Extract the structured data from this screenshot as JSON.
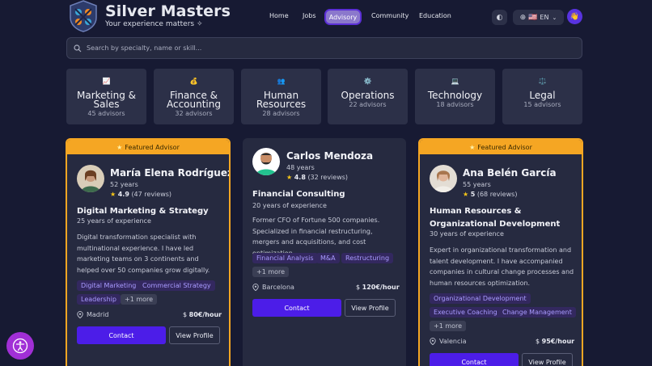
{
  "brand": {
    "title": "Silver Masters",
    "subtitle": "Your experience matters"
  },
  "nav": {
    "items": [
      "Home",
      "Jobs",
      "Advisory",
      "Community",
      "Education"
    ],
    "active": "Advisory"
  },
  "language": {
    "label": "EN",
    "flag": "🇺🇸"
  },
  "search": {
    "placeholder": "Search by specialty, name or skill..."
  },
  "categories": [
    {
      "icon": "📈",
      "icon_name": "chart-up-icon",
      "name_lines": [
        "Marketing &",
        "Sales"
      ],
      "count": "45 advisors"
    },
    {
      "icon": "💰",
      "icon_name": "money-bag-icon",
      "name_lines": [
        "Finance &",
        "Accounting"
      ],
      "count": "32 advisors"
    },
    {
      "icon": "👥",
      "icon_name": "people-icon",
      "name_lines": [
        "Human",
        "Resources"
      ],
      "count": "28 advisors"
    },
    {
      "icon": "⚙️",
      "icon_name": "gear-icon",
      "name_lines": [
        "Operations"
      ],
      "count": "22 advisors"
    },
    {
      "icon": "💻",
      "icon_name": "laptop-icon",
      "name_lines": [
        "Technology"
      ],
      "count": "18 advisors"
    },
    {
      "icon": "⚖️",
      "icon_name": "scales-icon",
      "name_lines": [
        "Legal"
      ],
      "count": "15 advisors"
    }
  ],
  "featured_label": "Featured Advisor",
  "advisors": [
    {
      "name": "María Elena Rodríguez",
      "age": "52 years",
      "rating": "4.9",
      "reviews": "(47 reviews)",
      "specialty": "Digital Marketing & Strategy",
      "experience": "25 years of experience",
      "bio": "Digital transformation specialist with multinational experience. I have led marketing teams on 3 continents and helped over 50 companies grow digitally.",
      "tags": [
        "Digital Marketing",
        "Commercial Strategy",
        "Leadership"
      ],
      "more": "+1 more",
      "location": "Madrid",
      "price": "80€/hour"
    },
    {
      "name": "Carlos Mendoza",
      "age": "48 years",
      "rating": "4.8",
      "reviews": "(32 reviews)",
      "specialty": "Financial Consulting",
      "experience": "20 years of experience",
      "bio": "Former CFO of Fortune 500 companies. Specialized in financial restructuring, mergers and acquisitions, and cost optimization.",
      "tags": [
        "Financial Analysis",
        "M&A",
        "Restructuring"
      ],
      "more": "+1 more",
      "location": "Barcelona",
      "price": "120€/hour"
    },
    {
      "name": "Ana Belén García",
      "age": "55 years",
      "rating": "5",
      "reviews": "(68 reviews)",
      "specialty": "Human Resources & Organizational Development",
      "experience": "30 years of experience",
      "bio": "Expert in organizational transformation and talent development. I have accompanied companies in cultural change processes and human resources optimization.",
      "tags": [
        "Organizational Development",
        "Executive Coaching",
        "Change Management"
      ],
      "more": "+1 more",
      "location": "Valencia",
      "price": "95€/hour"
    }
  ],
  "buttons": {
    "contact": "Contact",
    "view_profile": "View Profile"
  },
  "colors": {
    "background": "#171a33",
    "accent": "#4c1de8",
    "featured": "#f5a623",
    "tag_text": "#a99bff"
  }
}
